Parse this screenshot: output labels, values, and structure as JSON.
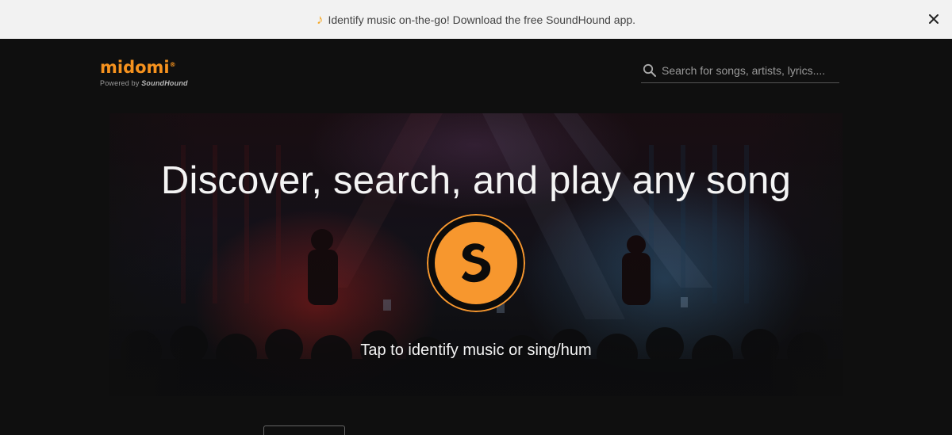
{
  "banner": {
    "icon": "music-note-icon",
    "text": "Identify music on-the-go! Download the free SoundHound app.",
    "close_icon": "close-icon"
  },
  "header": {
    "logo": {
      "wordmark": "midomi",
      "registered": "®",
      "powered_prefix": "Powered by ",
      "powered_brand": "SoundHound"
    },
    "search": {
      "icon": "search-icon",
      "placeholder": "Search for songs, artists, lyrics...."
    }
  },
  "hero": {
    "title": "Discover, search, and play any song",
    "button_icon": "soundhound-logo-icon",
    "tap_text": "Tap to identify music or sing/hum"
  },
  "colors": {
    "accent_orange": "#f7972e",
    "banner_bg": "#f2f2f2",
    "page_bg": "#0f0f0f"
  }
}
